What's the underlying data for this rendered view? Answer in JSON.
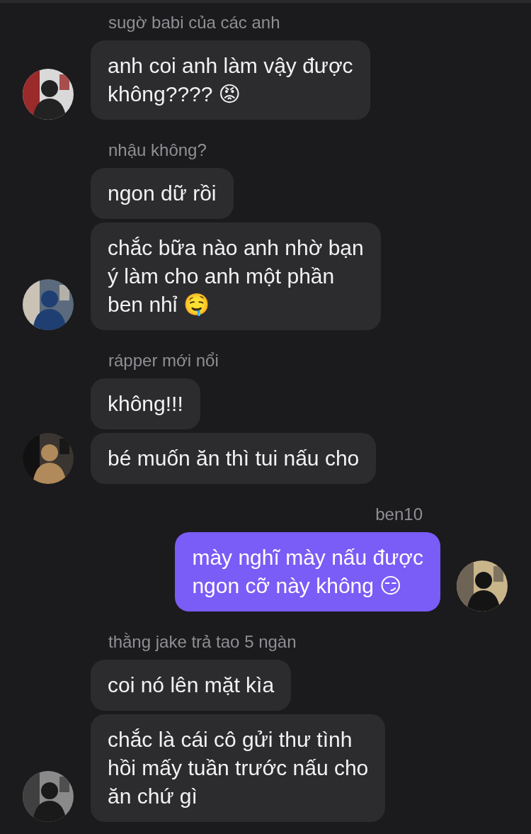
{
  "groups": [
    {
      "sender": "sugờ babi của các anh",
      "outgoing": false,
      "messages": [
        "anh coi anh làm vậy được\nkhông???? 😡"
      ]
    },
    {
      "sender": "nhậu không?",
      "outgoing": false,
      "messages": [
        "ngon dữ rồi",
        "chắc bữa nào anh nhờ bạn\ný làm cho anh một phần\nben nhỉ 🤤"
      ]
    },
    {
      "sender": "rápper mới nổi",
      "outgoing": false,
      "messages": [
        "không!!!",
        "bé muốn ăn thì tui nấu cho"
      ]
    },
    {
      "sender": "ben10",
      "outgoing": true,
      "messages": [
        "mày nghĩ mày nấu được\nngon cỡ này không 😏"
      ]
    },
    {
      "sender": "thằng jake trả tao 5 ngàn",
      "outgoing": false,
      "messages": [
        "coi nó lên mặt kìa",
        "chắc là cái cô gửi thư tình\nhồi mấy tuần trước nấu cho\năn chứ gì"
      ]
    }
  ]
}
